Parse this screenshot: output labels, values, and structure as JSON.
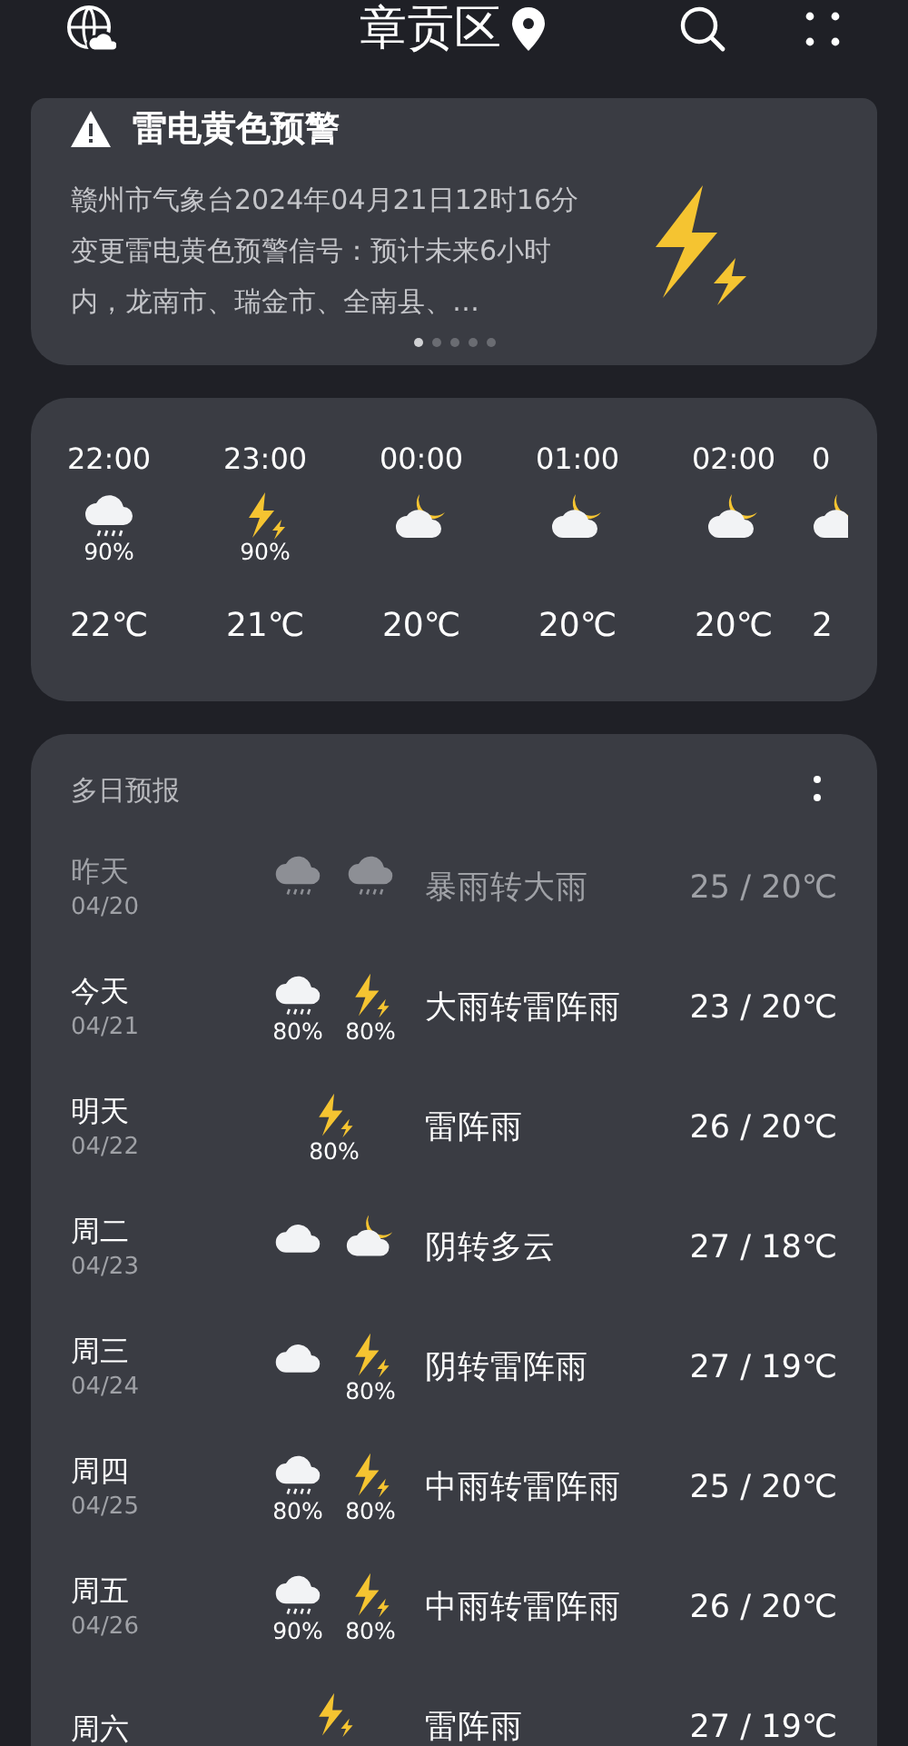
{
  "header": {
    "title": "章贡区"
  },
  "alert": {
    "title": "雷电黄色预警",
    "text": "赣州市气象台2024年04月21日12时16分变更雷电黄色预警信号：预计未来6小时内，龙南市、瑞金市、全南县、…",
    "pages": [
      {
        "selected": true
      },
      {
        "selected": false
      },
      {
        "selected": false
      },
      {
        "selected": false
      },
      {
        "selected": false
      }
    ]
  },
  "hourly": [
    {
      "time": "22:00",
      "kind": "rain",
      "precip": "90%",
      "temp": "22℃"
    },
    {
      "time": "23:00",
      "kind": "thunder",
      "precip": "90%",
      "temp": "21℃"
    },
    {
      "time": "00:00",
      "kind": "moon-cloud",
      "temp": "20℃"
    },
    {
      "time": "01:00",
      "kind": "moon-cloud",
      "temp": "20℃"
    },
    {
      "time": "02:00",
      "kind": "moon-cloud",
      "temp": "20℃"
    },
    {
      "time": "0",
      "kind": "moon-cloud",
      "temp": "2"
    }
  ],
  "daily": {
    "title": "多日预报",
    "days": [
      {
        "day": "昨天",
        "date": "04/20",
        "past": true,
        "icons": [
          {
            "kind": "rain"
          },
          {
            "kind": "rain"
          }
        ],
        "desc": "暴雨转大雨",
        "temp": "25 / 20℃"
      },
      {
        "day": "今天",
        "date": "04/21",
        "past": false,
        "icons": [
          {
            "kind": "rain",
            "precip": "80%"
          },
          {
            "kind": "thunder",
            "precip": "80%"
          }
        ],
        "desc": "大雨转雷阵雨",
        "temp": "23 / 20℃"
      },
      {
        "day": "明天",
        "date": "04/22",
        "past": false,
        "icons": [
          {
            "kind": "thunder",
            "precip": "80%"
          }
        ],
        "desc": "雷阵雨",
        "temp": "26 / 20℃"
      },
      {
        "day": "周二",
        "date": "04/23",
        "past": false,
        "icons": [
          {
            "kind": "cloud"
          },
          {
            "kind": "moon-cloud"
          }
        ],
        "desc": "阴转多云",
        "temp": "27 / 18℃"
      },
      {
        "day": "周三",
        "date": "04/24",
        "past": false,
        "icons": [
          {
            "kind": "cloud"
          },
          {
            "kind": "thunder",
            "precip": "80%"
          }
        ],
        "desc": "阴转雷阵雨",
        "temp": "27 / 19℃"
      },
      {
        "day": "周四",
        "date": "04/25",
        "past": false,
        "icons": [
          {
            "kind": "rain",
            "precip": "80%"
          },
          {
            "kind": "thunder",
            "precip": "80%"
          }
        ],
        "desc": "中雨转雷阵雨",
        "temp": "25 / 20℃"
      },
      {
        "day": "周五",
        "date": "04/26",
        "past": false,
        "icons": [
          {
            "kind": "rain",
            "precip": "90%"
          },
          {
            "kind": "thunder",
            "precip": "80%"
          }
        ],
        "desc": "中雨转雷阵雨",
        "temp": "26 / 20℃"
      },
      {
        "day": "周六",
        "past": false,
        "icons": [
          {
            "kind": "thunder"
          }
        ],
        "desc": "雷阵雨",
        "temp": "27 / 19℃"
      }
    ]
  }
}
